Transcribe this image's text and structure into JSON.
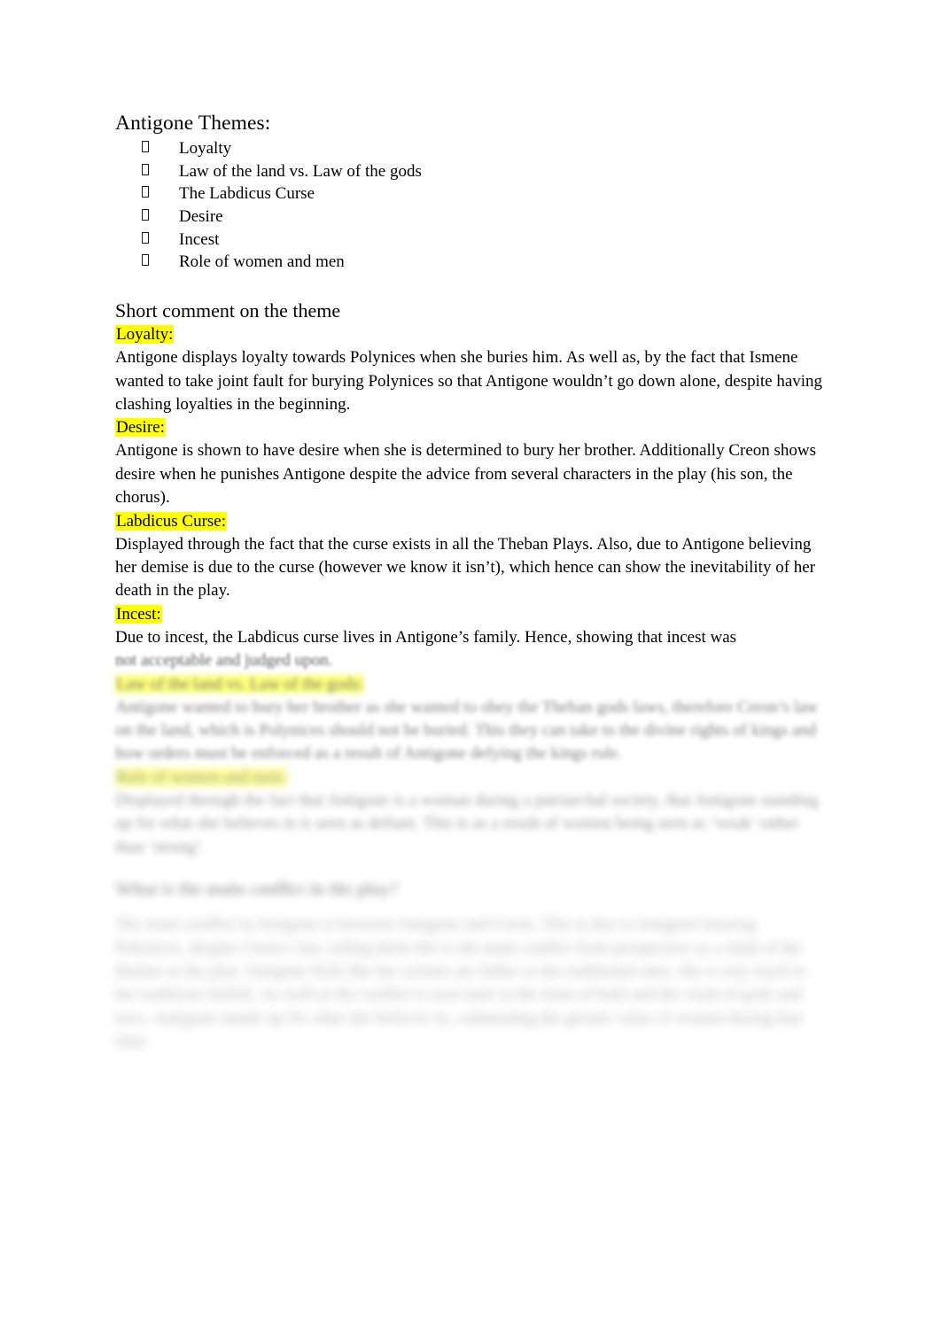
{
  "document": {
    "title": "Antigone Themes:",
    "bullet_glyph": "tofu-box"
  },
  "themes": {
    "items": [
      {
        "label": "Loyalty"
      },
      {
        "label": "Law of the land vs. Law of the gods"
      },
      {
        "label": "The Labdicus Curse"
      },
      {
        "label": "Desire"
      },
      {
        "label": "Incest"
      },
      {
        "label": "Role of women and men"
      }
    ]
  },
  "section": {
    "heading": "Short comment on the theme"
  },
  "comments": [
    {
      "heading": "Loyalty:",
      "highlight": "#ffff00",
      "body": "Antigone displays loyalty towards Polynices when she buries him. As well as, by the fact that Ismene wanted to take joint fault for burying Polynices so that Antigone wouldn’t go down alone, despite having clashing loyalties in the beginning."
    },
    {
      "heading": "Desire:",
      "highlight": "#ffff00",
      "body": "Antigone is shown to have desire when she is determined to bury her brother. Additionally Creon shows desire when he punishes Antigone despite the advice from several characters in the play (his son, the chorus)."
    },
    {
      "heading": "Labdicus Curse:",
      "highlight": "#ffff00",
      "body": "Displayed through the fact that the curse exists in all the Theban Plays. Also, due to Antigone believing her demise is due to the curse (however we know it isn’t), which hence can show the inevitability of her death in the play."
    },
    {
      "heading": "Incest:",
      "highlight": "#ffff00",
      "body": "Due to incest, the Labdicus curse lives in Antigone’s family. Hence, showing that incest was"
    }
  ],
  "blurred": {
    "incest_tail": "not acceptable and judged upon.",
    "sections": [
      {
        "heading": "Law of the land vs. Law of the gods:",
        "highlight": "#ffff00",
        "body": "Antigone wanted to bury her brother as she wanted to obey the Theban gods laws, therefore Creon’s law on the land, which is Polynices should not be buried. This they can take to the divine rights of kings and how orders must be enforced as a result of Antigone defying the kings rule."
      },
      {
        "heading": "Role of women and men:",
        "highlight": "#ffff00",
        "body": "Displayed through the fact that  Antigone  is a woman during a patriarchal society, that Antigone standing up for what she believes in is seen as defiant. This is as a result of women being seen as ‘weak’ rather than ‘strong’."
      }
    ],
    "question_heading": "What is the main conflict in the play?",
    "question_body": "The main conflict in  Antigone  is between Antigone and Creon. This is due to Antigone burying Polynices, despite Creon’s law, telling them this is the main conflict from perspective as a clash of the themes in the play.  Antigone feels like her actions are father or the traditional ones, she is very loyal to her traditions beliefs.  As well as the conflict is seen later in the form of both and the clash of gods and laws. Antigone stands up for what she believes in, culminating the greater value of women during that time."
  }
}
